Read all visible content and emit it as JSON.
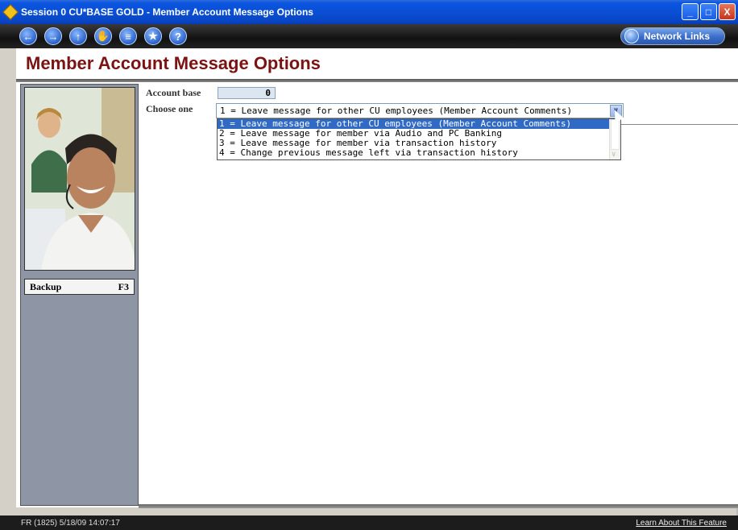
{
  "window": {
    "title": "Session 0 CU*BASE GOLD - Member Account Message Options",
    "minimize": "_",
    "maximize": "□",
    "close": "X"
  },
  "toolbar": {
    "buttons": [
      {
        "icon": "back-arrow-icon",
        "glyph": "←"
      },
      {
        "icon": "forward-arrow-icon",
        "glyph": "→"
      },
      {
        "icon": "up-arrow-icon",
        "glyph": "↑"
      },
      {
        "icon": "stop-hand-icon",
        "glyph": "✋"
      },
      {
        "icon": "print-icon",
        "glyph": "≡"
      },
      {
        "icon": "favorites-star-icon",
        "glyph": "★"
      },
      {
        "icon": "help-question-icon",
        "glyph": "?"
      }
    ],
    "network_links": "Network Links"
  },
  "page": {
    "title": "Member Account Message Options"
  },
  "form": {
    "account_base_label": "Account base",
    "account_base_value": "0",
    "choose_one_label": "Choose one",
    "selected": "1 = Leave message for other CU employees (Member Account Comments)",
    "options": [
      "1 = Leave message for other CU employees (Member Account Comments)",
      "2 = Leave message for member via Audio and PC Banking",
      "3 = Leave message for member via transaction history",
      "4 = Change previous message left via transaction history"
    ]
  },
  "sidebar": {
    "backup_label": "Backup",
    "backup_key": "F3"
  },
  "status": {
    "left": "FR (1825) 5/18/09 14:07:17",
    "right": "Learn About This Feature"
  },
  "colors": {
    "title_red": "#7b1313",
    "titlebar_blue": "#0a4fd4",
    "selected_option": "#316ac5",
    "sidebar": "#8e96a6"
  }
}
